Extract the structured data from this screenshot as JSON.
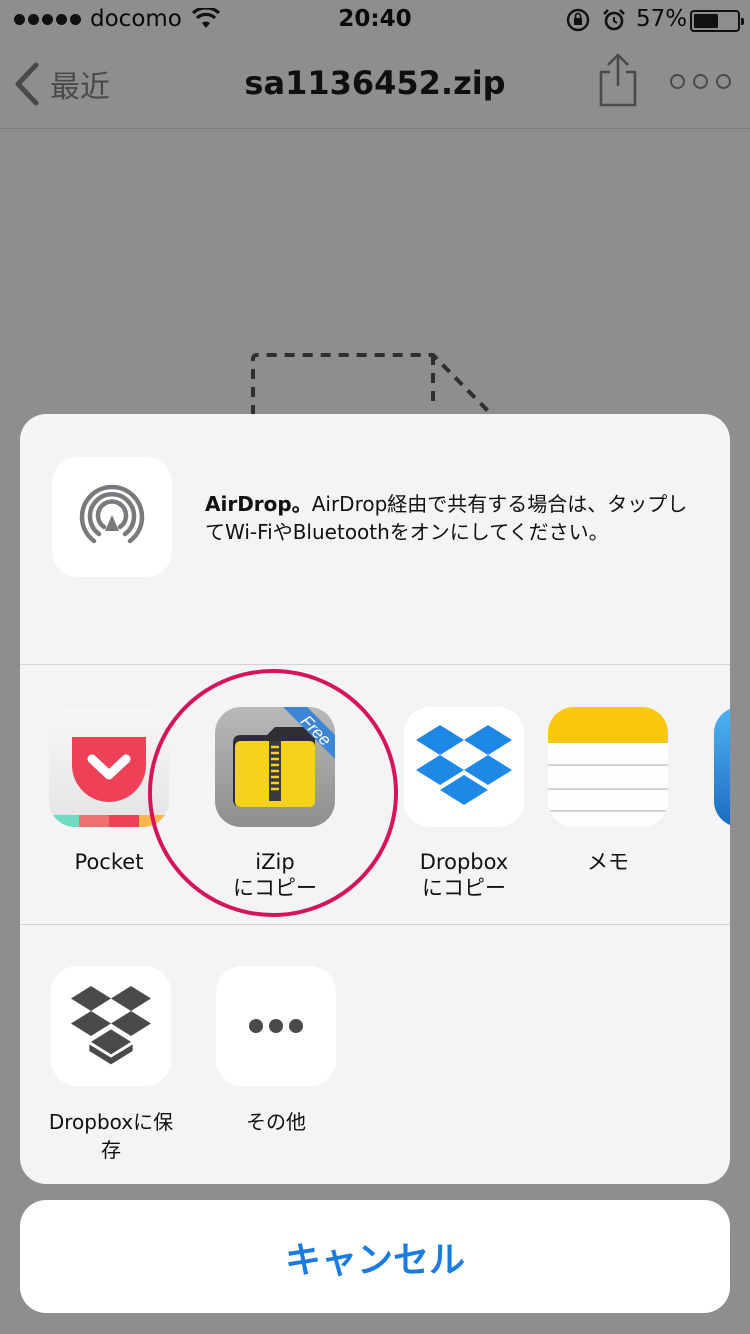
{
  "status_bar": {
    "carrier": "docomo",
    "time": "20:40",
    "battery_percent": "57%",
    "battery_level": 0.57
  },
  "nav": {
    "back_label": "最近",
    "title": "sa1136452.zip"
  },
  "airdrop": {
    "title": "AirDrop。",
    "description": "AirDrop経由で共有する場合は、タップしてWi-FiやBluetoothをオンにしてください。"
  },
  "apps": [
    {
      "label_line1": "Pocket",
      "label_line2": ""
    },
    {
      "label_line1": "iZip",
      "label_line2": "にコピー",
      "badge": "Free"
    },
    {
      "label_line1": "Dropbox",
      "label_line2": "にコピー"
    },
    {
      "label_line1": "メモ",
      "label_line2": ""
    }
  ],
  "actions": [
    {
      "label": "Dropboxに保存"
    },
    {
      "label": "その他"
    }
  ],
  "cancel_label": "キャンセル",
  "colors": {
    "accent": "#1b7ce0",
    "highlight": "#d6145a",
    "pocket_red": "#ee4056",
    "izip_yellow": "#f5d31a",
    "dropbox_blue": "#1e88e5",
    "notes_yellow": "#f9c80e"
  },
  "icons": {
    "airdrop": "airdrop-icon",
    "pocket": "pocket-icon",
    "izip": "izip-icon",
    "dropbox": "dropbox-icon",
    "notes": "notes-icon",
    "more": "ellipsis-icon"
  }
}
